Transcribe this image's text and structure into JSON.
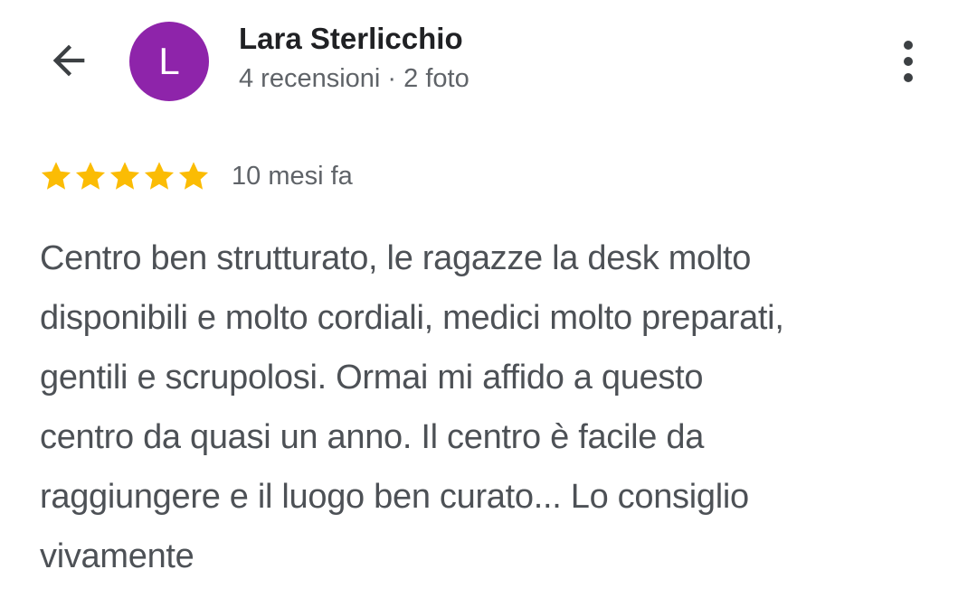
{
  "header": {
    "reviewer_name": "Lara Sterlicchio",
    "reviewer_meta": "4 recensioni · 2 foto",
    "avatar_initial": "L",
    "avatar_color": "#8e24aa",
    "back_icon": "arrow-back-icon",
    "more_icon": "more-vert-icon"
  },
  "review": {
    "rating": 5,
    "max_rating": 5,
    "star_color": "#fbbc04",
    "date": "10 mesi fa",
    "text_lines": [
      "Centro ben strutturato, le ragazze la desk molto",
      "disponibili e molto cordiali, medici molto preparati,",
      "gentili e scrupolosi. Ormai mi affido a questo",
      "centro da quasi un anno. Il centro è facile da",
      "raggiungere e il luogo ben curato... Lo consiglio",
      "vivamente"
    ]
  }
}
